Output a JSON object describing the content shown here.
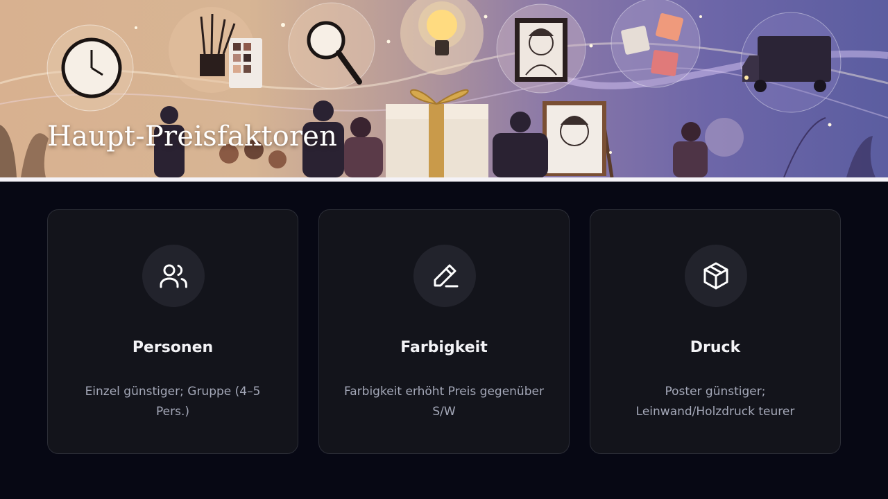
{
  "banner": {
    "title": "Haupt-Preisfaktoren",
    "illustration_alt": "Illustrated banner of caricature drawing: clock, brushes, magnifier, light bulb, framed portrait, puzzle pieces, delivery van, gift box, artist with easel"
  },
  "cards": [
    {
      "icon": "users-icon",
      "title": "Personen",
      "text": "Einzel günstiger; Gruppe (4–5 Pers.)"
    },
    {
      "icon": "pen-icon",
      "title": "Farbigkeit",
      "text": "Farbigkeit erhöht Preis gegenüber S/W"
    },
    {
      "icon": "box-icon",
      "title": "Druck",
      "text": "Poster günstiger; Leinwand/Holzdruck teurer"
    }
  ],
  "colors": {
    "background": "#070814",
    "card": "#13141b",
    "card_border": "#2c2e37",
    "icon_circle": "#22232c",
    "title": "#f3f3f6",
    "body_text": "#a4a8b8"
  }
}
